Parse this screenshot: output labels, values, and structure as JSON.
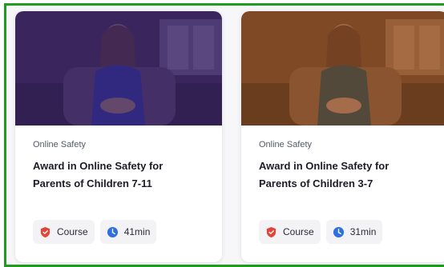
{
  "cards": [
    {
      "category": "Online Safety",
      "title": "Award in Online Safety for Parents of Children 7-11",
      "type_label": "Course",
      "duration": "41min",
      "thumb_tint": "#3a1f6b"
    },
    {
      "category": "Online Safety",
      "title": "Award in Online Safety for Parents of Children 3-7",
      "type_label": "Course",
      "duration": "31min",
      "thumb_tint": "#8a4a1e"
    }
  ],
  "colors": {
    "frame_border": "#1f9d1f",
    "course_icon": "#e0453a",
    "duration_icon": "#2f6fe0"
  }
}
